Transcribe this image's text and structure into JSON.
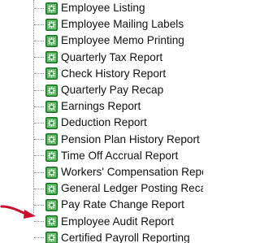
{
  "tree": {
    "items": [
      {
        "label": "Employee Listing",
        "icon": "report-node-icon"
      },
      {
        "label": "Employee Mailing Labels",
        "icon": "report-node-icon"
      },
      {
        "label": "Employee Memo Printing",
        "icon": "report-node-icon"
      },
      {
        "label": "Quarterly Tax Report",
        "icon": "report-node-icon"
      },
      {
        "label": "Check History Report",
        "icon": "report-node-icon"
      },
      {
        "label": "Quarterly Pay Recap",
        "icon": "report-node-icon"
      },
      {
        "label": "Earnings Report",
        "icon": "report-node-icon"
      },
      {
        "label": "Deduction Report",
        "icon": "report-node-icon"
      },
      {
        "label": "Pension Plan History Report",
        "icon": "report-node-icon"
      },
      {
        "label": "Time Off Accrual Report",
        "icon": "report-node-icon"
      },
      {
        "label": "Workers' Compensation Repo",
        "icon": "report-node-icon"
      },
      {
        "label": "General Ledger Posting Reca",
        "icon": "report-node-icon"
      },
      {
        "label": "Pay Rate Change Report",
        "icon": "report-node-icon"
      },
      {
        "label": "Employee Audit Report",
        "icon": "report-node-icon"
      },
      {
        "label": "Certified Payroll Reporting",
        "icon": "report-node-icon"
      }
    ]
  },
  "annotation": {
    "icon": "red-arrow-icon",
    "color": "#c8102e"
  },
  "colors": {
    "icon_fill": "#2e9a3a",
    "icon_border": "#1f6e27",
    "text": "#111111"
  }
}
